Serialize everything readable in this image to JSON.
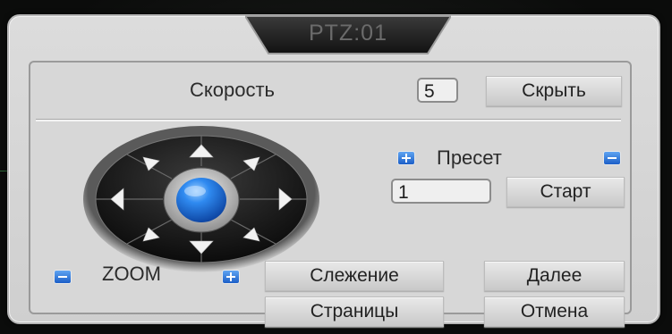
{
  "dialog": {
    "title": "PTZ:01"
  },
  "speed": {
    "label": "Скорость",
    "value": "5",
    "hide_button": "Скрыть"
  },
  "preset": {
    "label": "Пресет",
    "value": "1",
    "start_button": "Старт"
  },
  "zoom": {
    "label": "ZOOM"
  },
  "buttons": {
    "tracking": "Слежение",
    "next": "Далее",
    "pages": "Страницы",
    "cancel": "Отмена"
  },
  "icons": {
    "plus": "plus-icon",
    "minus": "minus-icon",
    "arrows": [
      "up",
      "up-right",
      "right",
      "down-right",
      "down",
      "down-left",
      "left",
      "up-left"
    ]
  },
  "colors": {
    "panel": "#d7d7d7",
    "accent_blue": "#1c6fd8",
    "pad_dark": "#1a1a1a"
  }
}
